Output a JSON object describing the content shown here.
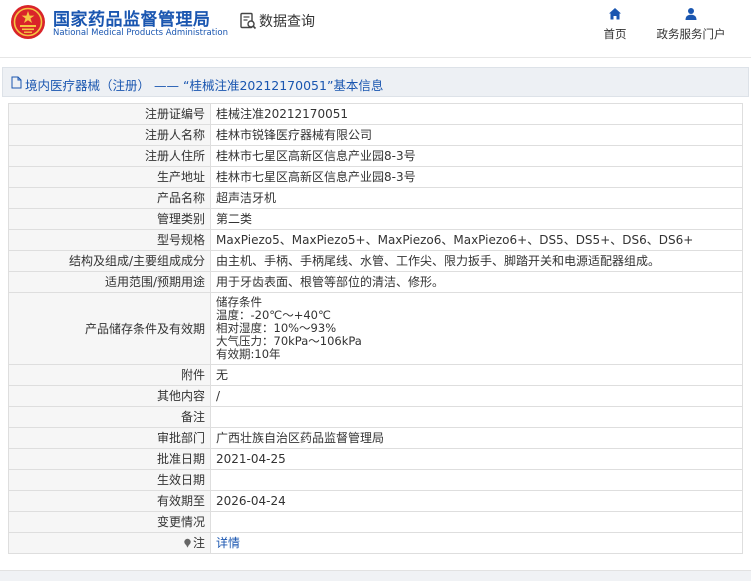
{
  "header": {
    "org_name_cn": "国家药品监督管理局",
    "org_name_en": "National Medical Products Administration",
    "query_label": "数据查询",
    "nav": [
      {
        "label": "首页",
        "icon": "home-icon"
      },
      {
        "label": "政务服务门户",
        "icon": "user-icon"
      }
    ]
  },
  "breadcrumb": {
    "category": "境内医疗器械（注册）",
    "separator": "——",
    "title": "“桂械注准20212170051”基本信息"
  },
  "rows": [
    {
      "label": "注册证编号",
      "value": "桂械注准20212170051"
    },
    {
      "label": "注册人名称",
      "value": "桂林市锐锋医疗器械有限公司"
    },
    {
      "label": "注册人住所",
      "value": "桂林市七星区高新区信息产业园8-3号"
    },
    {
      "label": "生产地址",
      "value": "桂林市七星区高新区信息产业园8-3号"
    },
    {
      "label": "产品名称",
      "value": "超声洁牙机"
    },
    {
      "label": "管理类别",
      "value": "第二类"
    },
    {
      "label": "型号规格",
      "value": "MaxPiezo5、MaxPiezo5+、MaxPiezo6、MaxPiezo6+、DS5、DS5+、DS6、DS6+"
    },
    {
      "label": "结构及组成/主要组成成分",
      "value": "由主机、手柄、手柄尾线、水管、工作尖、限力扳手、脚踏开关和电源适配器组成。"
    },
    {
      "label": "适用范围/预期用途",
      "value": "用于牙齿表面、根管等部位的清洁、修形。"
    },
    {
      "label": "产品储存条件及有效期",
      "lines": [
        "储存条件",
        "温度：-20℃～+40℃",
        "相对湿度：10%～93%",
        "大气压力：70kPa～106kPa",
        "有效期:10年"
      ]
    },
    {
      "label": "附件",
      "value": "无"
    },
    {
      "label": "其他内容",
      "value": "/"
    },
    {
      "label": "备注",
      "value": ""
    },
    {
      "label": "审批部门",
      "value": "广西壮族自治区药品监督管理局"
    },
    {
      "label": "批准日期",
      "value": "2021-04-25"
    },
    {
      "label": "生效日期",
      "value": ""
    },
    {
      "label": "有效期至",
      "value": "2026-04-24"
    },
    {
      "label": "变更情况",
      "value": ""
    },
    {
      "label": "注",
      "value": "详情"
    }
  ]
}
